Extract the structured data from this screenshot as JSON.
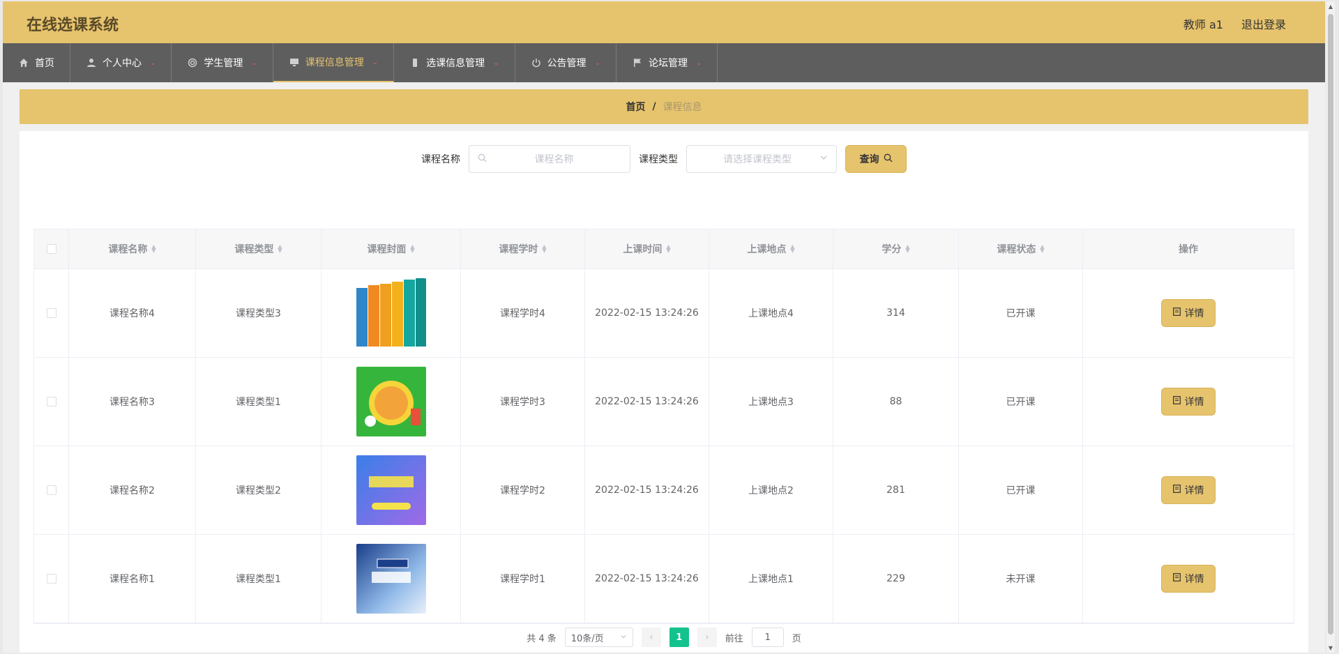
{
  "app": {
    "title": "在线选课系统"
  },
  "user": {
    "name": "教师 a1",
    "logout": "退出登录"
  },
  "nav": [
    {
      "label": "首页",
      "icon": "home-icon",
      "active": false,
      "caret": false
    },
    {
      "label": "个人中心",
      "icon": "user-icon",
      "active": false,
      "caret": true
    },
    {
      "label": "学生管理",
      "icon": "gear-icon",
      "active": false,
      "caret": true
    },
    {
      "label": "课程信息管理",
      "icon": "monitor-icon",
      "active": true,
      "caret": true
    },
    {
      "label": "选课信息管理",
      "icon": "phone-icon",
      "active": false,
      "caret": true
    },
    {
      "label": "公告管理",
      "icon": "power-icon",
      "active": false,
      "caret": true
    },
    {
      "label": "论坛管理",
      "icon": "flag-icon",
      "active": false,
      "caret": true
    }
  ],
  "breadcrumb": {
    "home": "首页",
    "separator": "/",
    "current": "课程信息"
  },
  "search": {
    "name_label": "课程名称",
    "name_placeholder": "课程名称",
    "type_label": "课程类型",
    "type_placeholder": "请选择课程类型",
    "query_button": "查询"
  },
  "table": {
    "headers": [
      "课程名称",
      "课程类型",
      "课程封面",
      "课程学时",
      "上课时间",
      "上课地点",
      "学分",
      "课程状态",
      "操作"
    ],
    "rows": [
      {
        "name": "课程名称4",
        "type": "课程类型3",
        "cover": "cover-books",
        "hours": "课程学时4",
        "time": "2022-02-15 13:24:26",
        "place": "上课地点4",
        "credit": "314",
        "status": "已开课",
        "action": "详情"
      },
      {
        "name": "课程名称3",
        "type": "课程类型1",
        "cover": "cover-math",
        "hours": "课程学时3",
        "time": "2022-02-15 13:24:26",
        "place": "上课地点3",
        "credit": "88",
        "status": "已开课",
        "action": "详情"
      },
      {
        "name": "课程名称2",
        "type": "课程类型2",
        "cover": "cover-physics",
        "hours": "课程学时2",
        "time": "2022-02-15 13:24:26",
        "place": "上课地点2",
        "credit": "281",
        "status": "已开课",
        "action": "详情"
      },
      {
        "name": "课程名称1",
        "type": "课程类型1",
        "cover": "cover-exam",
        "hours": "课程学时1",
        "time": "2022-02-15 13:24:26",
        "place": "上课地点1",
        "credit": "229",
        "status": "未开课",
        "action": "详情"
      }
    ]
  },
  "pagination": {
    "total": "共 4 条",
    "page_size": "10条/页",
    "current_page": "1",
    "goto_label": "前往",
    "goto_value": "1",
    "goto_suffix": "页"
  },
  "colors": {
    "accent": "#e6c36d",
    "nav_bg": "#5e5e5e",
    "page_active": "#13c28d"
  }
}
